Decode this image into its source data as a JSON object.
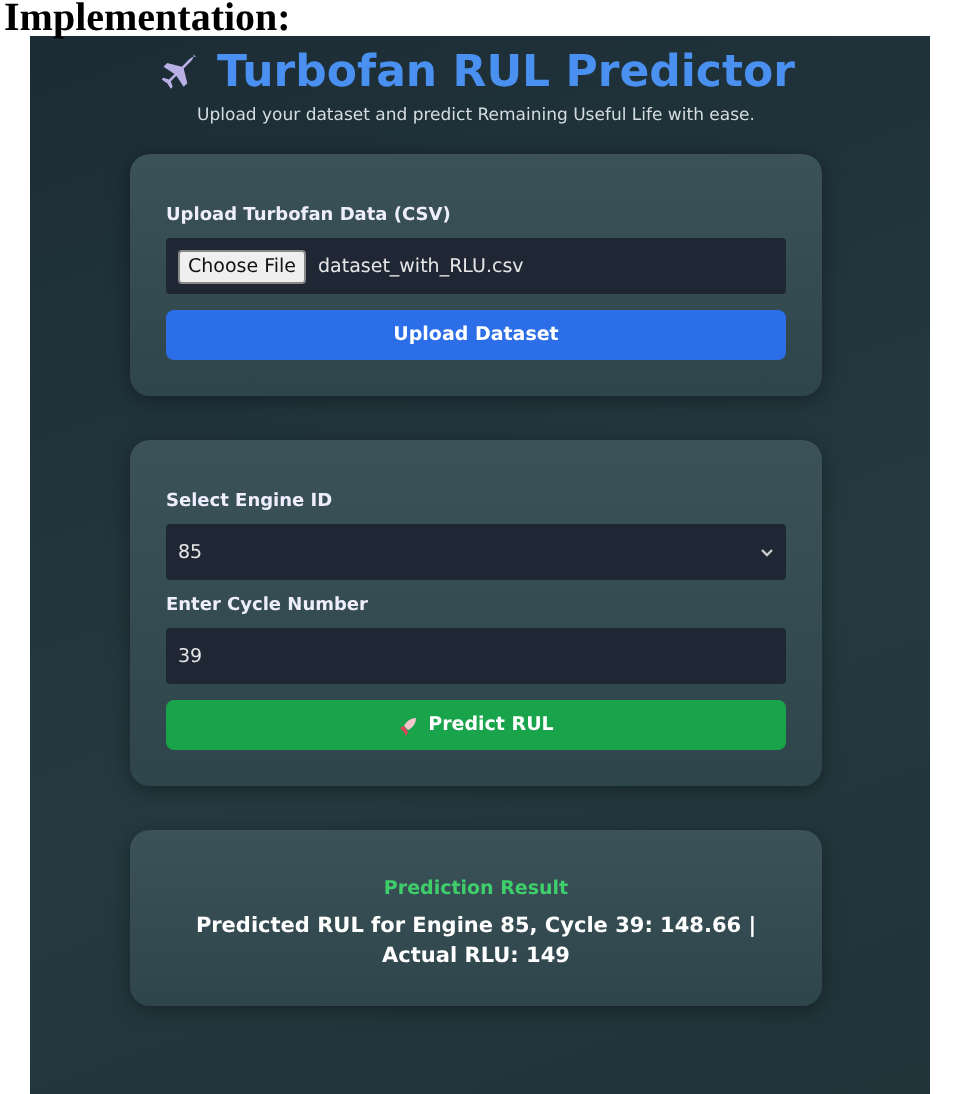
{
  "document": {
    "heading": "Implementation:"
  },
  "app": {
    "title": "Turbofan RUL Predictor",
    "subtitle": "Upload your dataset and predict Remaining Useful Life with ease.",
    "upload_card": {
      "label": "Upload Turbofan Data (CSV)",
      "file_button": "Choose File",
      "file_name": "dataset_with_RLU.csv",
      "button": "Upload Dataset"
    },
    "predict_card": {
      "engine_label": "Select Engine ID",
      "engine_value": "85",
      "cycle_label": "Enter Cycle Number",
      "cycle_value": "39",
      "button": "Predict RUL"
    },
    "result_card": {
      "title": "Prediction Result",
      "text": "Predicted RUL for Engine 85, Cycle 39: 148.66 | Actual RLU: 149"
    }
  }
}
